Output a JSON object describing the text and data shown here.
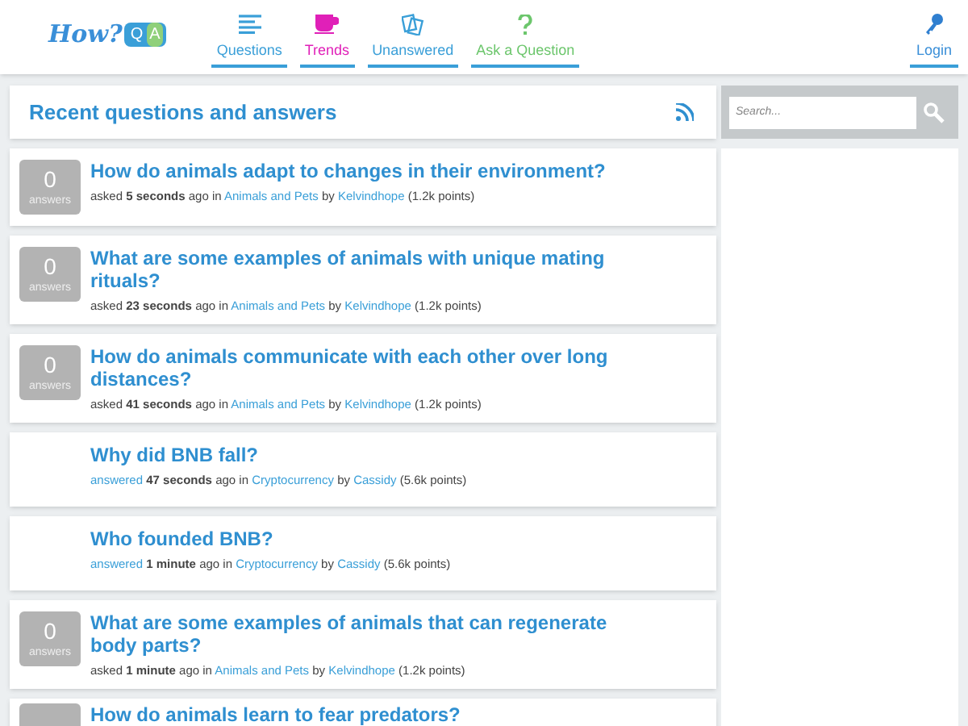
{
  "logo": {
    "how": "How?",
    "q": "Q",
    "a": "A"
  },
  "nav": [
    {
      "label": "Questions",
      "kind": "lines",
      "color": "#3a9fd8"
    },
    {
      "label": "Trends",
      "kind": "cup",
      "color": "#e020b8"
    },
    {
      "label": "Unanswered",
      "kind": "cards",
      "color": "#3a9fd8"
    },
    {
      "label": "Ask a Question",
      "kind": "question",
      "color": "#6cc66c"
    }
  ],
  "login": {
    "label": "Login"
  },
  "heading": "Recent questions and answers",
  "search": {
    "placeholder": "Search..."
  },
  "questions": [
    {
      "title": "How do animals adapt to changes in their environment?",
      "answers": {
        "count": "0",
        "label": "answers"
      },
      "verb": "asked",
      "verb_link": false,
      "time": "5 seconds",
      "ago_in": "ago in",
      "category": "Animals and Pets",
      "by": "by",
      "user": "Kelvindhope",
      "points": "(1.2k points)"
    },
    {
      "title": "What are some examples of animals with unique mating rituals?",
      "answers": {
        "count": "0",
        "label": "answers"
      },
      "verb": "asked",
      "verb_link": false,
      "time": "23 seconds",
      "ago_in": "ago in",
      "category": "Animals and Pets",
      "by": "by",
      "user": "Kelvindhope",
      "points": "(1.2k points)"
    },
    {
      "title": "How do animals communicate with each other over long distances?",
      "answers": {
        "count": "0",
        "label": "answers"
      },
      "verb": "asked",
      "verb_link": false,
      "time": "41 seconds",
      "ago_in": "ago in",
      "category": "Animals and Pets",
      "by": "by",
      "user": "Kelvindhope",
      "points": "(1.2k points)"
    },
    {
      "title": "Why did BNB fall?",
      "verb": "answered",
      "verb_link": true,
      "time": "47 seconds",
      "ago_in": "ago in",
      "category": "Cryptocurrency",
      "by": "by",
      "user": "Cassidy",
      "points": "(5.6k points)"
    },
    {
      "title": "Who founded BNB?",
      "verb": "answered",
      "verb_link": true,
      "time": "1 minute",
      "ago_in": "ago in",
      "category": "Cryptocurrency",
      "by": "by",
      "user": "Cassidy",
      "points": "(5.6k points)"
    },
    {
      "title": "What are some examples of animals that can regenerate body parts?",
      "answers": {
        "count": "0",
        "label": "answers"
      },
      "verb": "asked",
      "verb_link": false,
      "time": "1 minute",
      "ago_in": "ago in",
      "category": "Animals and Pets",
      "by": "by",
      "user": "Kelvindhope",
      "points": "(1.2k points)"
    }
  ],
  "partial_question": {
    "title": "How do animals learn to fear predators?"
  }
}
